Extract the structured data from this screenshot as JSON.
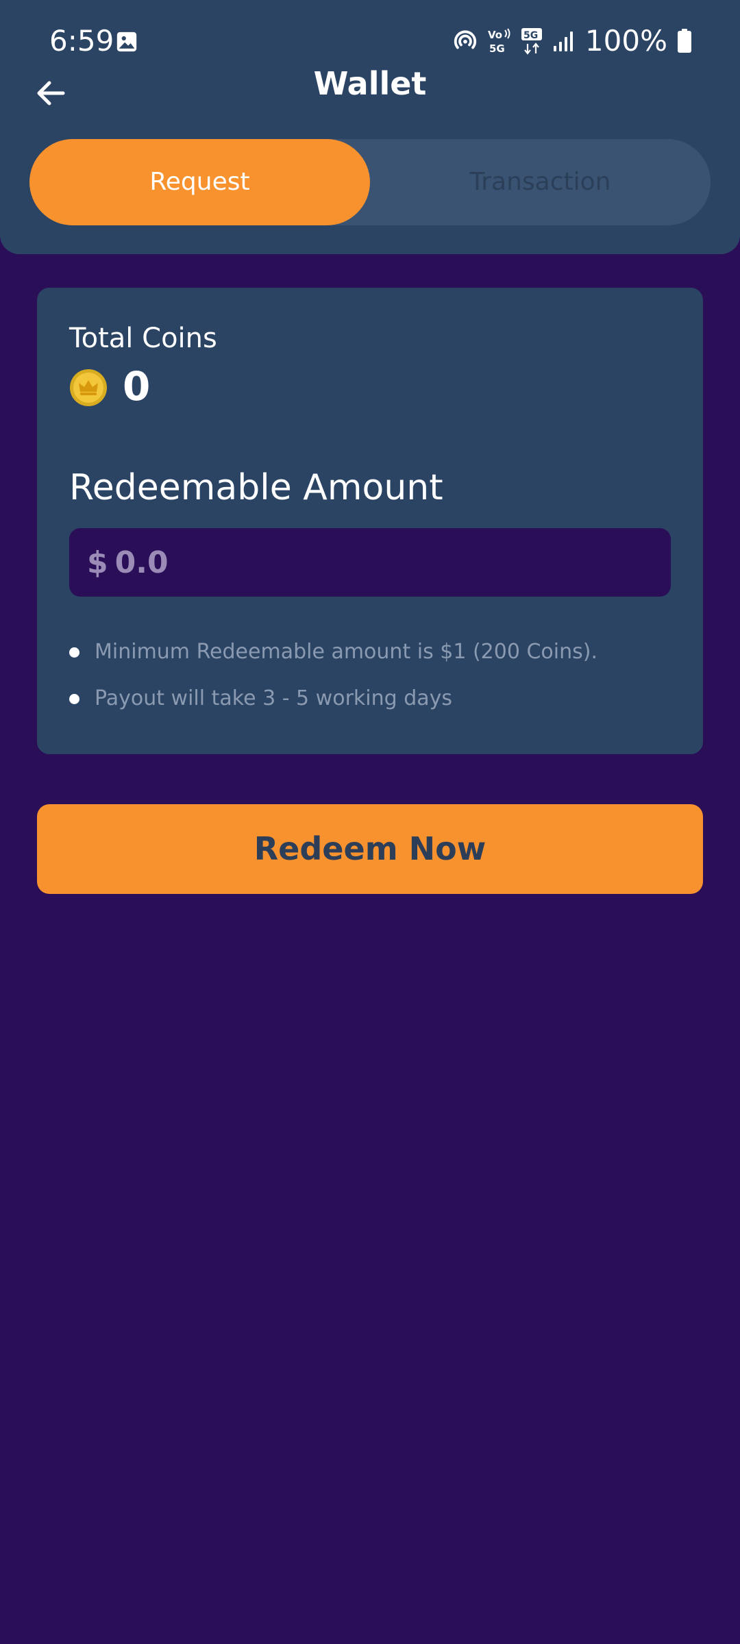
{
  "status_bar": {
    "time": "6:59",
    "battery_text": "100%",
    "icons": [
      "gallery-icon",
      "hotspot-icon",
      "volte-5g-icon",
      "5g-data-icon",
      "signal-icon",
      "battery-icon"
    ]
  },
  "header": {
    "title": "Wallet",
    "back_icon": "arrow-left-icon"
  },
  "tabs": [
    {
      "label": "Request",
      "active": true
    },
    {
      "label": "Transaction",
      "active": false
    }
  ],
  "wallet": {
    "total_coins_label": "Total Coins",
    "coin_icon": "coin-crown-icon",
    "total_coins_value": "0",
    "redeemable_label": "Redeemable Amount",
    "amount_currency": "$",
    "amount_placeholder": "0.0",
    "notes": [
      "Minimum Redeemable amount is $1 (200 Coins).",
      "Payout will take 3 - 5 working days"
    ]
  },
  "redeem_button_label": "Redeem Now",
  "colors": {
    "background": "#2a0f58",
    "panel": "#2c4464",
    "accent": "#f8922f",
    "tab_track": "#3b5372",
    "muted_text": "#8a9ab1"
  }
}
